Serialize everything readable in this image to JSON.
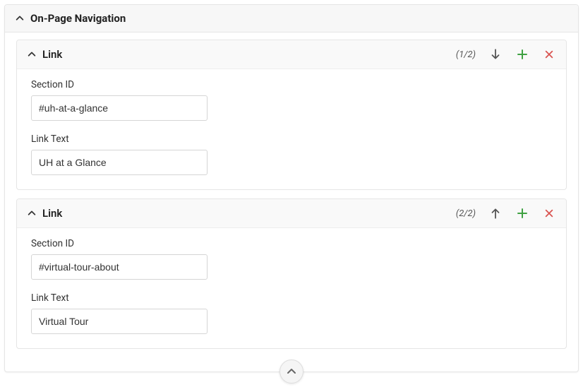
{
  "panel": {
    "title": "On-Page Navigation"
  },
  "links": [
    {
      "title": "Link",
      "counter": "(1/2)",
      "section_id_label": "Section ID",
      "section_id_value": "#uh-at-a-glance",
      "link_text_label": "Link Text",
      "link_text_value": "UH at a Glance",
      "show_up": false,
      "show_down": true
    },
    {
      "title": "Link",
      "counter": "(2/2)",
      "section_id_label": "Section ID",
      "section_id_value": "#virtual-tour-about",
      "link_text_label": "Link Text",
      "link_text_value": "Virtual Tour",
      "show_up": true,
      "show_down": false
    }
  ]
}
